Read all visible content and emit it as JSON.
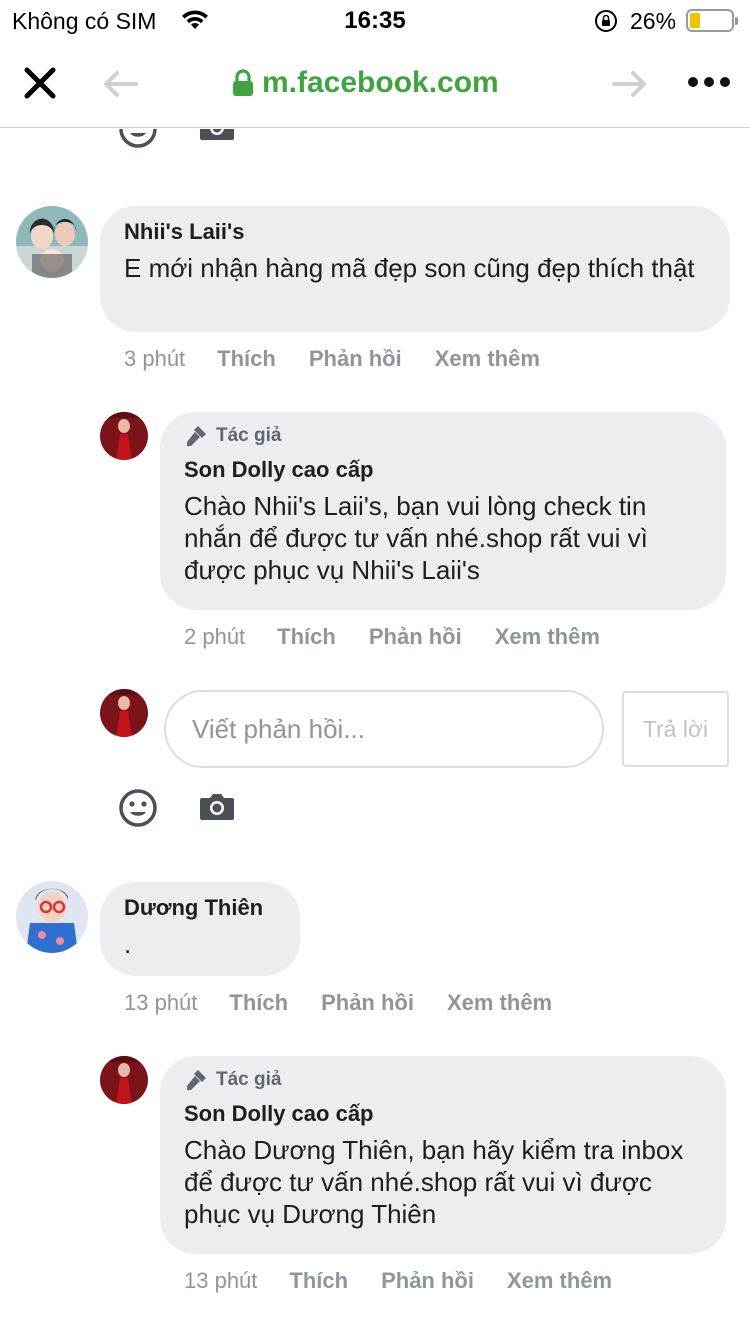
{
  "status_bar": {
    "carrier": "Không có SIM",
    "time": "16:35",
    "battery_percent": "26%",
    "battery_level": 0.26,
    "battery_color": "#f2c200"
  },
  "browser": {
    "url": "m.facebook.com",
    "url_color": "#3fa43f",
    "icons": [
      "close-icon",
      "back-arrow-icon",
      "lock-icon",
      "forward-arrow-icon",
      "more-icon"
    ]
  },
  "thread": {
    "comments": [
      {
        "author": "Nhii's Laii's",
        "text": "E mới nhận hàng mã đẹp son cũng đẹp thích thật",
        "time": "3 phút",
        "actions": [
          "Thích",
          "Phản hồi",
          "Xem thêm"
        ],
        "reply": {
          "badge": "Tác giả",
          "author": "Son Dolly cao cấp",
          "text": "Chào Nhii's Laii's, bạn vui lòng check tin nhắn để được tư vấn nhé.shop rất vui vì được phục vụ Nhii's Laii's",
          "time": "2 phút",
          "actions": [
            "Thích",
            "Phản hồi",
            "Xem thêm"
          ]
        },
        "reply_box": {
          "placeholder": "Viết phản hồi...",
          "button": "Trả lời"
        }
      },
      {
        "author": "Dương Thiên",
        "text": ".",
        "time": "13 phút",
        "actions": [
          "Thích",
          "Phản hồi",
          "Xem thêm"
        ],
        "reply": {
          "badge": "Tác giả",
          "author": "Son Dolly cao cấp",
          "text": "Chào Dương Thiên, bạn hãy kiểm tra inbox để được tư vấn nhé.shop rất vui vì được phục vụ Dương Thiên",
          "time": "13 phút",
          "actions": [
            "Thích",
            "Phản hồi",
            "Xem thêm"
          ]
        }
      }
    ]
  }
}
